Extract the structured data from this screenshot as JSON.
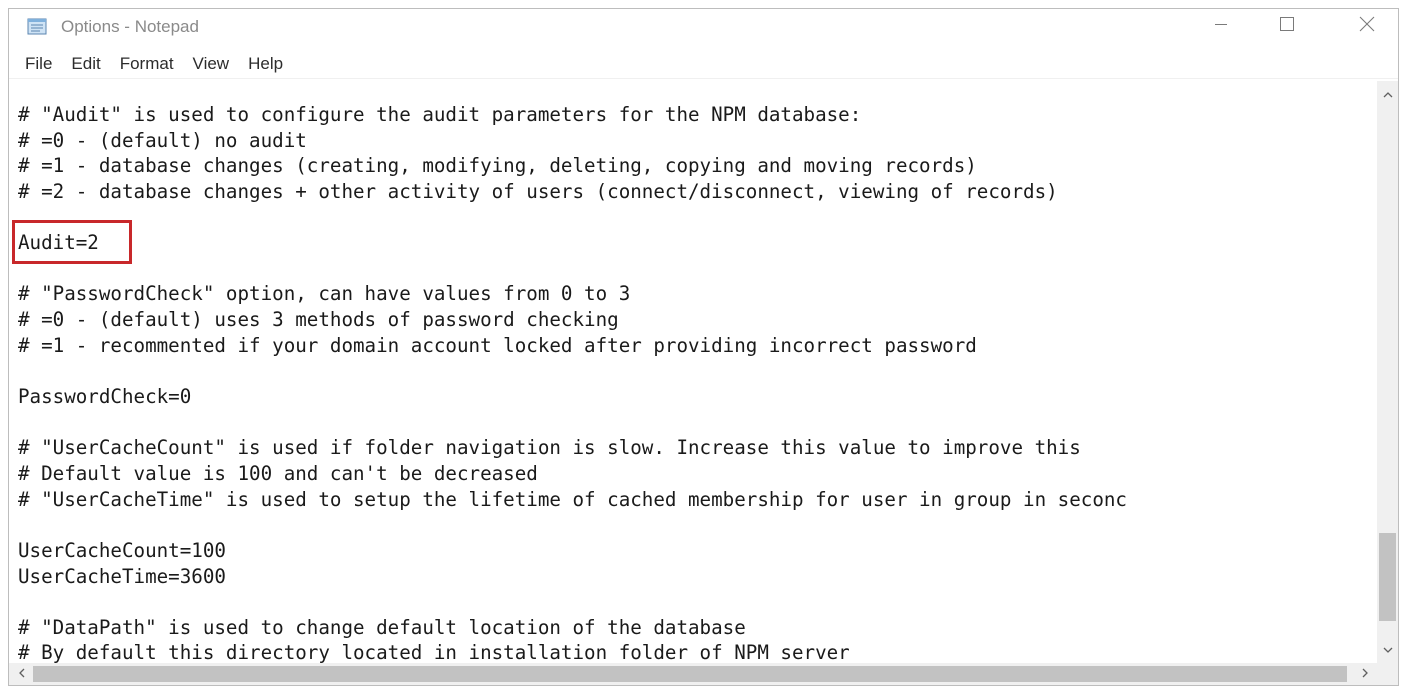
{
  "window": {
    "title": "Options - Notepad",
    "icon": "notepad-icon",
    "controls": [
      "minimize-icon",
      "maximize-icon",
      "close-icon"
    ]
  },
  "menu": {
    "items": [
      {
        "label": "File"
      },
      {
        "label": "Edit"
      },
      {
        "label": "Format"
      },
      {
        "label": "View"
      },
      {
        "label": "Help"
      }
    ]
  },
  "editor": {
    "lines": [
      "# \"Audit\" is used to configure the audit parameters for the NPM database:",
      "# =0 - (default) no audit",
      "# =1 - database changes (creating, modifying, deleting, copying and moving records)",
      "# =2 - database changes + other activity of users (connect/disconnect, viewing of records)",
      "",
      "Audit=2",
      "",
      "# \"PasswordCheck\" option, can have values from 0 to 3",
      "# =0 - (default) uses 3 methods of password checking",
      "# =1 - recommented if your domain account locked after providing incorrect password",
      "",
      "PasswordCheck=0",
      "",
      "# \"UserCacheCount\" is used if folder navigation is slow. Increase this value to improve this",
      "# Default value is 100 and can't be decreased",
      "# \"UserCacheTime\" is used to setup the lifetime of cached membership for user in group in seconc",
      "",
      "UserCacheCount=100",
      "UserCacheTime=3600",
      "",
      "# \"DataPath\" is used to change default location of the database",
      "# By default this directory located in installation folder of NPM server"
    ],
    "highlighted_line": "Audit=2",
    "highlight_color": "#c8282a"
  },
  "scrollbars": {
    "vertical_position": 0.78,
    "horizontal_position": 0.0
  }
}
